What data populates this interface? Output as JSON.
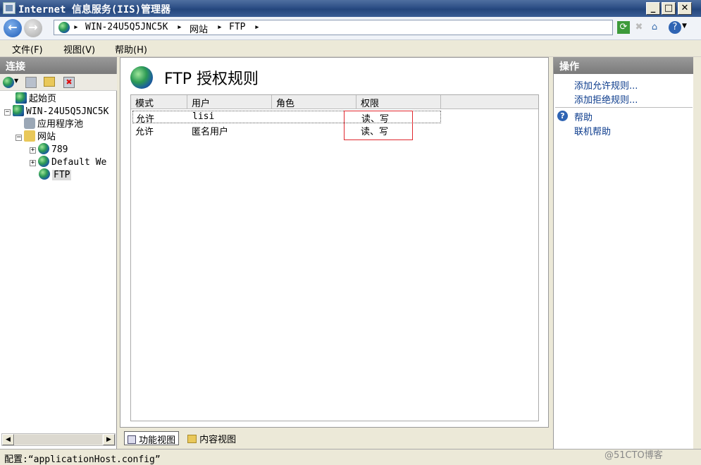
{
  "window": {
    "title": "Internet 信息服务(IIS)管理器"
  },
  "address": {
    "parts": [
      "WIN-24U5Q5JNC5K",
      "网站",
      "FTP"
    ],
    "separator": "▸"
  },
  "menu": {
    "file": "文件(F)",
    "view": "视图(V)",
    "help": "帮助(H)"
  },
  "connections": {
    "title": "连接",
    "tree": {
      "start": "起始页",
      "server": "WIN-24U5Q5JNC5K",
      "apppools": "应用程序池",
      "sites": "网站",
      "site1": "789",
      "site2": "Default We",
      "site3": "FTP"
    }
  },
  "main": {
    "title": "FTP 授权规则",
    "columns": [
      "模式",
      "用户",
      "角色",
      "权限"
    ],
    "rows": [
      {
        "mode": "允许",
        "user": "lisi",
        "role": "",
        "perm": "读、写"
      },
      {
        "mode": "允许",
        "user": "匿名用户",
        "role": "",
        "perm": "读、写"
      }
    ]
  },
  "views": {
    "features": "功能视图",
    "content": "内容视图"
  },
  "actions": {
    "title": "操作",
    "add_allow": "添加允许规则...",
    "add_deny": "添加拒绝规则...",
    "help": "帮助",
    "online_help": "联机帮助"
  },
  "status": {
    "text": "配置:“applicationHost.config”"
  },
  "watermark": "@51CTO博客",
  "colors": {
    "titlebar": "#2d4f86",
    "highlight_box": "#e0282e",
    "link": "#0b3b8c"
  }
}
